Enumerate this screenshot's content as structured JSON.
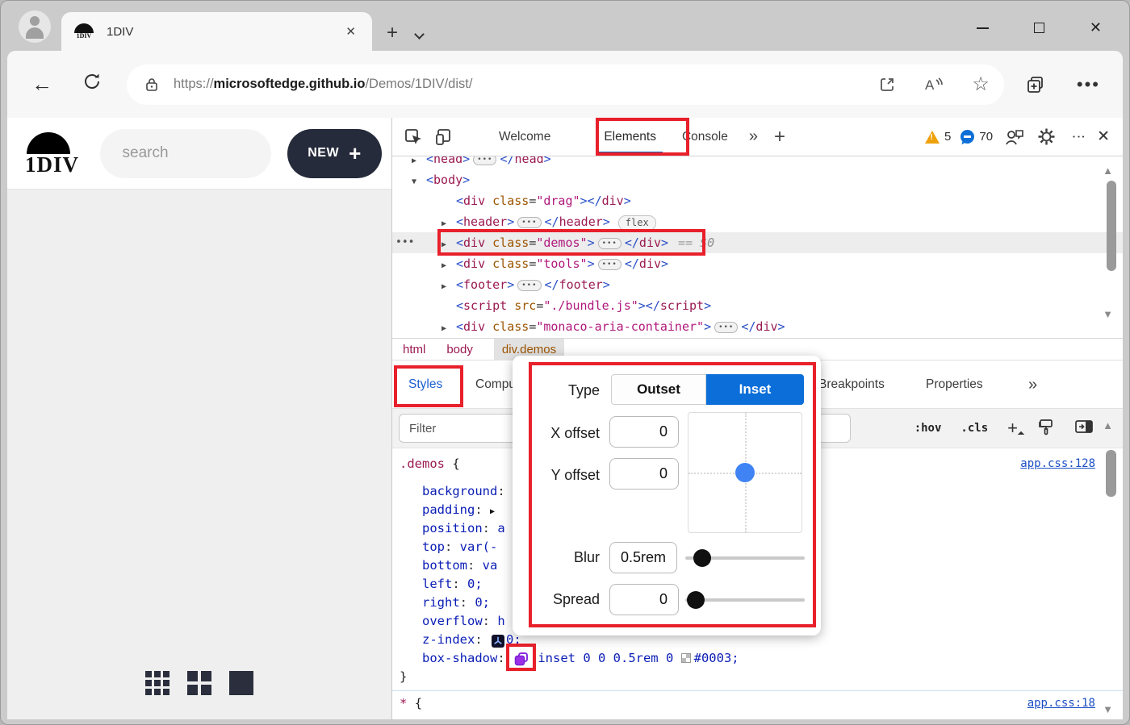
{
  "colors": {
    "annotation_red": "#e8202b",
    "accent_blue": "#0b6ed9",
    "dot_blue": "#3f83f5",
    "link_blue": "#1b4fc4",
    "warn_orange": "#efa10c",
    "chat_blue": "#0c6fd6",
    "app_dark": "#262b3b"
  },
  "browser": {
    "tab": {
      "title": "1DIV",
      "favicon_text": "1DIV",
      "close_glyph": "✕"
    },
    "newtab_plus": "+",
    "url": {
      "scheme": "https://",
      "domain": "microsoftedge.github.io",
      "path": "/Demos/1DIV/dist/"
    },
    "back_glyph": "←",
    "dots_glyph": "•••"
  },
  "app": {
    "logo_text": "1DIV",
    "search_placeholder": "search",
    "new_button_label": "NEW",
    "new_button_plus": "+"
  },
  "devtools": {
    "toolbar": {
      "tabs": [
        "Welcome",
        "Elements",
        "Console"
      ],
      "more_glyph": "»",
      "plus_glyph": "+",
      "warning_count": "5",
      "issue_count": "70"
    },
    "dom_tree": {
      "lines": [
        {
          "indent": 1,
          "arrow": "▶",
          "cut": true,
          "tokens": [
            [
              "brk",
              "<"
            ],
            [
              "tag",
              "head"
            ],
            [
              "brk",
              ">"
            ],
            [
              "ell",
              ""
            ],
            [
              "brk",
              "</"
            ],
            [
              "tag",
              "head"
            ],
            [
              "brk",
              ">"
            ]
          ]
        },
        {
          "indent": 1,
          "arrow": "▼",
          "tokens": [
            [
              "brk",
              "<"
            ],
            [
              "tag",
              "body"
            ],
            [
              "brk",
              ">"
            ]
          ]
        },
        {
          "indent": 2,
          "arrow": "",
          "tokens": [
            [
              "brk",
              "<"
            ],
            [
              "tag",
              "div"
            ],
            [
              "plain",
              " "
            ],
            [
              "attr",
              "class"
            ],
            [
              "plain",
              "="
            ],
            [
              "val",
              "\"drag\""
            ],
            [
              "brk",
              "></"
            ],
            [
              "tag",
              "div"
            ],
            [
              "brk",
              ">"
            ]
          ]
        },
        {
          "indent": 2,
          "arrow": "▶",
          "badge": "flex",
          "tokens": [
            [
              "brk",
              "<"
            ],
            [
              "tag",
              "header"
            ],
            [
              "brk",
              ">"
            ],
            [
              "ell",
              ""
            ],
            [
              "brk",
              "</"
            ],
            [
              "tag",
              "header"
            ],
            [
              "brk",
              ">"
            ]
          ]
        },
        {
          "indent": 2,
          "arrow": "▶",
          "selected": true,
          "gutter": "•••",
          "redbox": true,
          "tokens": [
            [
              "brk",
              "<"
            ],
            [
              "tag",
              "div"
            ],
            [
              "plain",
              " "
            ],
            [
              "attr",
              "class"
            ],
            [
              "plain",
              "="
            ],
            [
              "val",
              "\"demos\""
            ],
            [
              "brk",
              ">"
            ],
            [
              "ell",
              ""
            ],
            [
              "brk",
              "</"
            ],
            [
              "tag",
              "div"
            ],
            [
              "brk",
              ">"
            ]
          ],
          "suffix": [
            [
              "meta",
              "== "
            ],
            [
              "metai",
              "$0"
            ]
          ]
        },
        {
          "indent": 2,
          "arrow": "▶",
          "tokens": [
            [
              "brk",
              "<"
            ],
            [
              "tag",
              "div"
            ],
            [
              "plain",
              " "
            ],
            [
              "attr",
              "class"
            ],
            [
              "plain",
              "="
            ],
            [
              "val",
              "\"tools\""
            ],
            [
              "brk",
              ">"
            ],
            [
              "ell",
              ""
            ],
            [
              "brk",
              "</"
            ],
            [
              "tag",
              "div"
            ],
            [
              "brk",
              ">"
            ]
          ]
        },
        {
          "indent": 2,
          "arrow": "▶",
          "tokens": [
            [
              "brk",
              "<"
            ],
            [
              "tag",
              "footer"
            ],
            [
              "brk",
              ">"
            ],
            [
              "ell",
              ""
            ],
            [
              "brk",
              "</"
            ],
            [
              "tag",
              "footer"
            ],
            [
              "brk",
              ">"
            ]
          ]
        },
        {
          "indent": 2,
          "arrow": "",
          "tokens": [
            [
              "brk",
              "<"
            ],
            [
              "tag",
              "script"
            ],
            [
              "plain",
              " "
            ],
            [
              "attr",
              "src"
            ],
            [
              "plain",
              "="
            ],
            [
              "val",
              "\"./bundle.js\""
            ],
            [
              "brk",
              "></"
            ],
            [
              "tag",
              "script"
            ],
            [
              "brk",
              ">"
            ]
          ]
        },
        {
          "indent": 2,
          "arrow": "▶",
          "tokens": [
            [
              "brk",
              "<"
            ],
            [
              "tag",
              "div"
            ],
            [
              "plain",
              " "
            ],
            [
              "attr",
              "class"
            ],
            [
              "plain",
              "="
            ],
            [
              "val",
              "\"monaco-aria-container\""
            ],
            [
              "brk",
              ">"
            ],
            [
              "ell",
              ""
            ],
            [
              "brk",
              "</"
            ],
            [
              "tag",
              "div"
            ],
            [
              "brk",
              ">"
            ]
          ]
        }
      ]
    },
    "breadcrumb": {
      "items": [
        "html",
        "body",
        "div.demos"
      ]
    },
    "styles_tabs": {
      "styles": "Styles",
      "computed": "Computed",
      "breakpoints": "Breakpoints",
      "properties": "Properties",
      "more_glyph": "»"
    },
    "filter_placeholder": "Filter",
    "pseudo_label": ":hov",
    "cls_label": ".cls",
    "rules": {
      "demos": {
        "selector": ".demos",
        "open_brace": "{",
        "close_brace": "}",
        "link": "app.css:128",
        "lines": [
          [
            [
              "prop",
              "background"
            ],
            [
              "plain",
              ":"
            ]
          ],
          [
            [
              "prop",
              "padding"
            ],
            [
              "plain",
              ": "
            ],
            [
              "expand",
              "▶"
            ]
          ],
          [
            [
              "prop",
              "position"
            ],
            [
              "plain",
              ": "
            ],
            [
              "pval",
              "a"
            ]
          ],
          [
            [
              "prop",
              "top"
            ],
            [
              "plain",
              ": "
            ],
            [
              "pval",
              "var(-"
            ]
          ],
          [
            [
              "prop",
              "bottom"
            ],
            [
              "plain",
              ": "
            ],
            [
              "pval",
              "va"
            ]
          ],
          [
            [
              "prop",
              "left"
            ],
            [
              "plain",
              ": "
            ],
            [
              "pval",
              "0;"
            ]
          ],
          [
            [
              "prop",
              "right"
            ],
            [
              "plain",
              ": "
            ],
            [
              "pval",
              "0;"
            ]
          ],
          [
            [
              "prop",
              "overflow"
            ],
            [
              "plain",
              ": "
            ],
            [
              "pval",
              "h"
            ]
          ],
          [
            [
              "prop",
              "z-index"
            ],
            [
              "plain",
              ": "
            ],
            [
              "icon3d",
              ""
            ],
            [
              "pval",
              "0;"
            ]
          ],
          [
            [
              "prop",
              "box-shadow"
            ],
            [
              "plain",
              ": "
            ],
            [
              "iconshadow",
              ""
            ],
            [
              "pval",
              " inset 0 0 0.5rem 0 "
            ],
            [
              "swatch",
              ""
            ],
            [
              "pval",
              "#0003;"
            ]
          ]
        ]
      },
      "star": {
        "selector": "*",
        "open_brace": "{",
        "link": "app.css:18"
      }
    },
    "popup": {
      "type_label": "Type",
      "outset_label": "Outset",
      "inset_label": "Inset",
      "x_label": "X offset",
      "x_value": "0",
      "y_label": "Y offset",
      "y_value": "0",
      "blur_label": "Blur",
      "blur_value": "0.5rem",
      "spread_label": "Spread",
      "spread_value": "0"
    }
  }
}
